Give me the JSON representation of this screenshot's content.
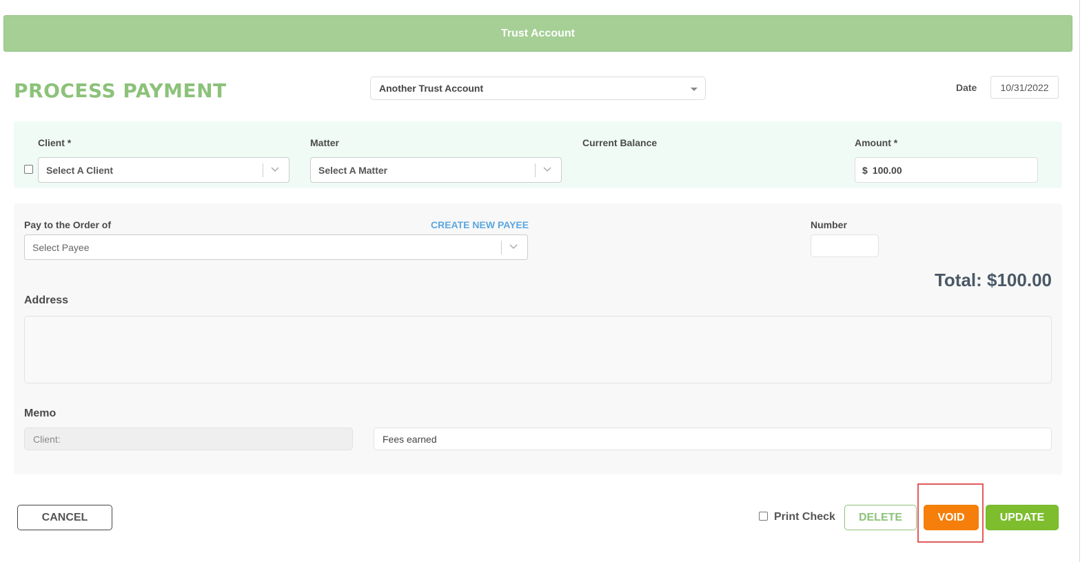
{
  "banner": {
    "title": "Trust Account"
  },
  "page": {
    "title": "PROCESS PAYMENT"
  },
  "account_select": {
    "value": "Another Trust Account"
  },
  "date": {
    "label": "Date",
    "value": "10/31/2022"
  },
  "client_section": {
    "client_label": "Client *",
    "client_placeholder": "Select A Client",
    "matter_label": "Matter",
    "matter_placeholder": "Select A Matter",
    "balance_label": "Current Balance",
    "amount_label": "Amount *",
    "amount_currency": "$",
    "amount_value": "100.00"
  },
  "payee_section": {
    "pay_to_label": "Pay to the Order of",
    "create_payee_link": "CREATE NEW PAYEE",
    "payee_placeholder": "Select Payee",
    "number_label": "Number",
    "number_value": "",
    "total": "Total: $100.00",
    "address_label": "Address",
    "memo_label": "Memo",
    "memo_client_placeholder": "Client:",
    "memo_text": "Fees earned"
  },
  "actions": {
    "cancel": "CANCEL",
    "print_check": "Print Check",
    "delete": "DELETE",
    "void": "VOID",
    "update": "UPDATE"
  },
  "colors": {
    "banner": "#a5cf95",
    "title_green": "#8cc27a",
    "link_blue": "#5aa6e0",
    "void_orange": "#f57f0a",
    "update_green": "#7dbd2e",
    "highlight_red": "#e35a5a"
  }
}
